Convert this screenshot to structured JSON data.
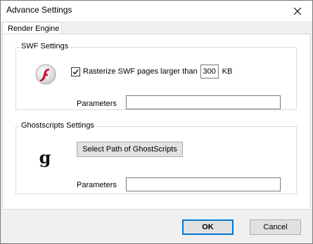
{
  "window": {
    "title": "Advance Settings"
  },
  "tabs": [
    {
      "label": "Render Engine"
    }
  ],
  "swf": {
    "group_label": "SWF Settings",
    "rasterize_label": "Rasterize SWF pages larger than",
    "rasterize_checked": true,
    "size_value": "300",
    "size_unit": "KB",
    "params_label": "Parameters",
    "params_value": ""
  },
  "ghostscript": {
    "group_label": "Ghostscripts Settings",
    "select_path_label": "Select Path of GhostScripts",
    "params_label": "Parameters",
    "params_value": ""
  },
  "footer": {
    "ok_label": "OK",
    "cancel_label": "Cancel"
  },
  "icons": {
    "close": "close-icon",
    "flash": "flash-icon",
    "ghostscript": "ghostscript-icon",
    "check": "checkmark-icon"
  },
  "colors": {
    "accent": "#0078d7",
    "flash_red": "#c8102e"
  }
}
